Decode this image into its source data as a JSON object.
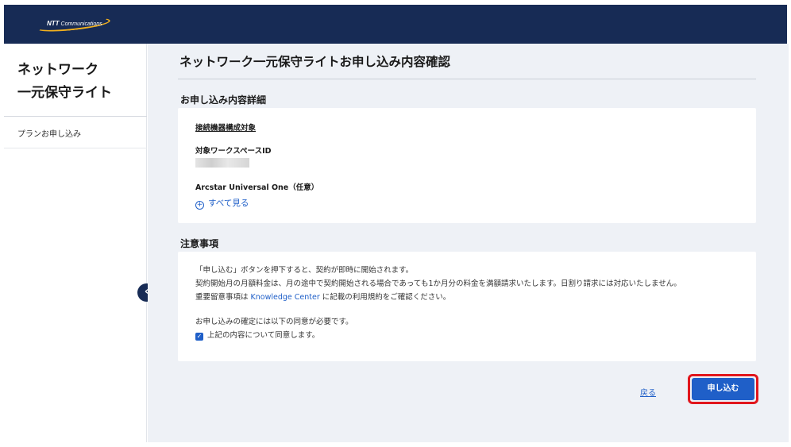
{
  "header": {
    "logo_text_bold": "NTT",
    "logo_text": "Communications"
  },
  "sidebar": {
    "title_line1": "ネットワーク",
    "title_line2": "一元保守ライト",
    "items": [
      {
        "label": "プランお申し込み"
      }
    ],
    "collapse_icon": "‹"
  },
  "main": {
    "page_title": "ネットワーク一元保守ライトお申し込み内容確認",
    "details_section": {
      "title": "お申し込み内容詳細",
      "connected_device_label": "接続機器構成対象",
      "workspace_id_label": "対象ワークスペースID",
      "arcstar_label": "Arcstar Universal One（任意）",
      "see_all_label": "すべて見る"
    },
    "notes_section": {
      "title": "注意事項",
      "line1": "「申し込む」ボタンを押下すると、契約が即時に開始されます。",
      "line2": "契約開始月の月額料金は、月の途中で契約開始される場合であっても1か月分の料金を満額請求いたします。日割り請求には対応いたしません。",
      "line3_prefix": "重要留意事項は ",
      "line3_link": "Knowledge Center",
      "line3_suffix": " に記載の利用規約をご確認ください。",
      "consent_required": "お申し込みの確定には以下の同意が必要です。",
      "consent_checkbox_label": "上記の内容について同意します。",
      "consent_checked": true
    },
    "back_label": "戻る",
    "submit_label": "申し込む"
  },
  "colors": {
    "header_bg": "#172b55",
    "accent": "#1f5fc8",
    "highlight": "#e1161c",
    "main_bg": "#eef1f6"
  }
}
